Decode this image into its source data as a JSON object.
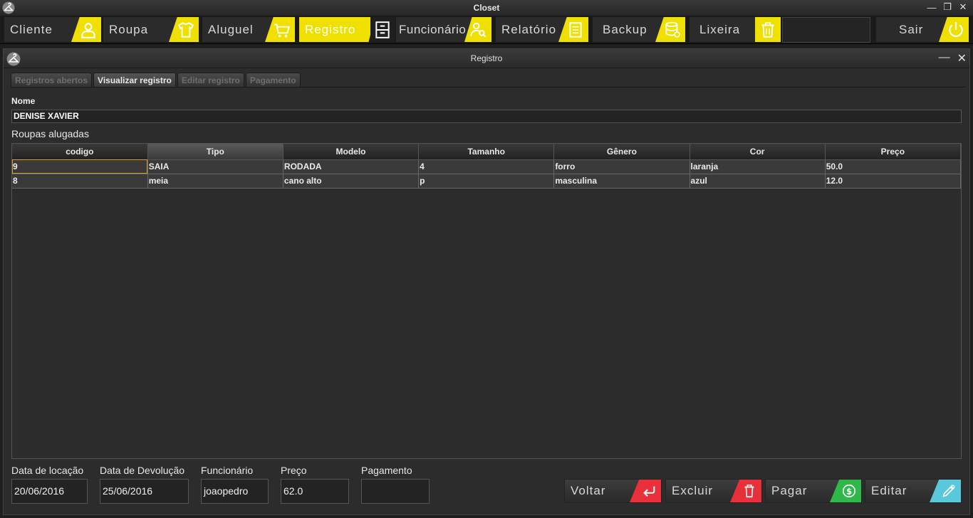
{
  "window": {
    "title": "Closet"
  },
  "menu": {
    "items": [
      {
        "label": "Cliente",
        "icon": "user-icon"
      },
      {
        "label": "Roupa",
        "icon": "shirt-icon"
      },
      {
        "label": "Aluguel",
        "icon": "cart-icon"
      },
      {
        "label": "Registro",
        "icon": "cabinet-icon",
        "active": true
      },
      {
        "label": "Funcionário",
        "icon": "employee-search-icon"
      },
      {
        "label": "Relatório",
        "icon": "report-icon"
      },
      {
        "label": "Backup",
        "icon": "database-icon"
      },
      {
        "label": "Lixeira",
        "icon": "trash-icon"
      }
    ],
    "exit_label": "Sair",
    "accent": "#f0e000"
  },
  "inner_window": {
    "title": "Registro"
  },
  "tabs": [
    {
      "label": "Registros abertos"
    },
    {
      "label": "Visualizar registro",
      "active": true
    },
    {
      "label": "Editar registro"
    },
    {
      "label": "Pagamento"
    }
  ],
  "form": {
    "nome_label": "Nome",
    "nome_value": "DENISE XAVIER",
    "roupas_label": "Roupas alugadas"
  },
  "table": {
    "columns": [
      "codigo",
      "Tipo",
      "Modelo",
      "Tamanho",
      "Gênero",
      "Cor",
      "Preço"
    ],
    "rows": [
      [
        "9",
        "SAIA",
        "RODADA",
        "4",
        "forro",
        "laranja",
        "50.0"
      ],
      [
        "8",
        "meia",
        "cano alto",
        "p",
        "masculina",
        "azul",
        "12.0"
      ]
    ]
  },
  "details": {
    "data_locacao_label": "Data de locação",
    "data_locacao_value": "20/06/2016",
    "data_devolucao_label": "Data de Devolução",
    "data_devolucao_value": "25/06/2016",
    "funcionario_label": "Funcionário",
    "funcionario_value": "joaopedro",
    "preco_label": "Preço",
    "preco_value": "62.0",
    "pagamento_label": "Pagamento",
    "pagamento_value": ""
  },
  "actions": {
    "voltar": {
      "label": "Voltar",
      "color": "#e8303a"
    },
    "excluir": {
      "label": "Excluir",
      "color": "#e8303a"
    },
    "pagar": {
      "label": "Pagar",
      "color": "#2eb84a"
    },
    "editar": {
      "label": "Editar",
      "color": "#5ac8dc"
    }
  }
}
